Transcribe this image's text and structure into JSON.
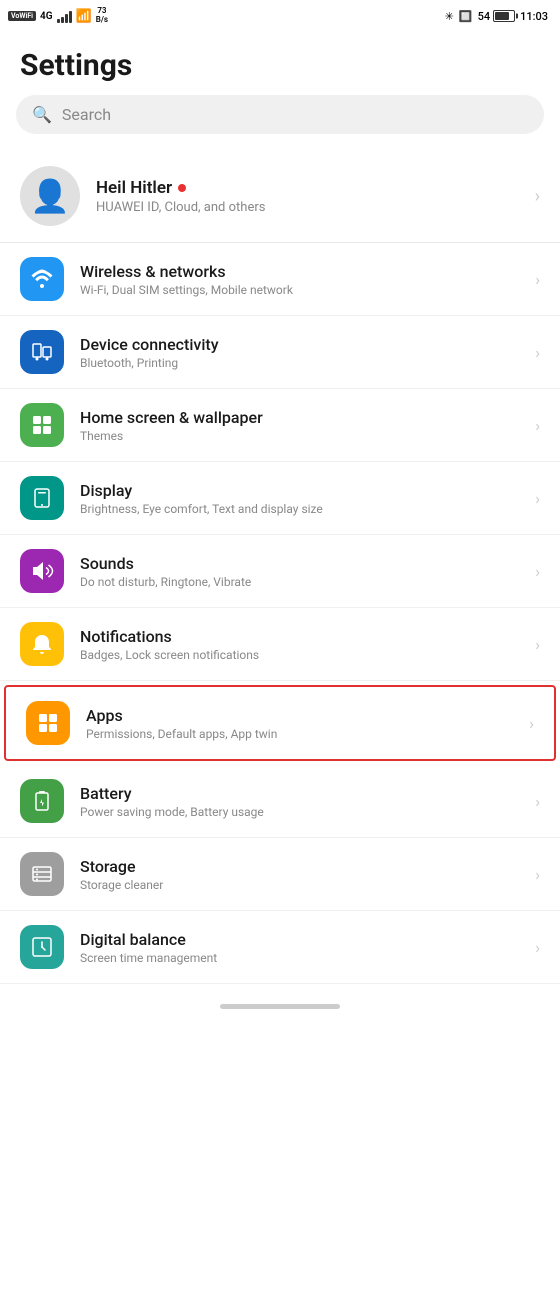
{
  "status_bar": {
    "left": {
      "vowifi": "VoWiFi",
      "network": "4G",
      "speed": "73\nB/s"
    },
    "right": {
      "battery_pct": "54",
      "time": "11:03"
    }
  },
  "page": {
    "title": "Settings"
  },
  "search": {
    "placeholder": "Search"
  },
  "profile": {
    "name": "Heil Hitler",
    "subtitle": "HUAWEI ID, Cloud, and others",
    "has_dot": true
  },
  "settings_items": [
    {
      "id": "wireless",
      "icon_unicode": "📶",
      "icon_color": "icon-blue",
      "title": "Wireless & networks",
      "subtitle": "Wi-Fi, Dual SIM settings, Mobile network",
      "highlighted": false
    },
    {
      "id": "device-connectivity",
      "icon_unicode": "📱",
      "icon_color": "icon-blue2",
      "title": "Device connectivity",
      "subtitle": "Bluetooth, Printing",
      "highlighted": false
    },
    {
      "id": "home-screen",
      "icon_unicode": "🖼",
      "icon_color": "icon-green",
      "title": "Home screen & wallpaper",
      "subtitle": "Themes",
      "highlighted": false
    },
    {
      "id": "display",
      "icon_unicode": "📱",
      "icon_color": "icon-teal",
      "title": "Display",
      "subtitle": "Brightness, Eye comfort, Text and display size",
      "highlighted": false
    },
    {
      "id": "sounds",
      "icon_unicode": "🔊",
      "icon_color": "icon-purple",
      "title": "Sounds",
      "subtitle": "Do not disturb, Ringtone, Vibrate",
      "highlighted": false
    },
    {
      "id": "notifications",
      "icon_unicode": "🔔",
      "icon_color": "icon-yellow",
      "title": "Notifications",
      "subtitle": "Badges, Lock screen notifications",
      "highlighted": false
    },
    {
      "id": "apps",
      "icon_unicode": "⊞",
      "icon_color": "icon-orange",
      "title": "Apps",
      "subtitle": "Permissions, Default apps, App twin",
      "highlighted": true
    },
    {
      "id": "battery",
      "icon_unicode": "🔋",
      "icon_color": "icon-green2",
      "title": "Battery",
      "subtitle": "Power saving mode, Battery usage",
      "highlighted": false
    },
    {
      "id": "storage",
      "icon_unicode": "💾",
      "icon_color": "icon-gray",
      "title": "Storage",
      "subtitle": "Storage cleaner",
      "highlighted": false
    },
    {
      "id": "digital-balance",
      "icon_unicode": "⏳",
      "icon_color": "icon-teal2",
      "title": "Digital balance",
      "subtitle": "Screen time management",
      "highlighted": false
    }
  ]
}
